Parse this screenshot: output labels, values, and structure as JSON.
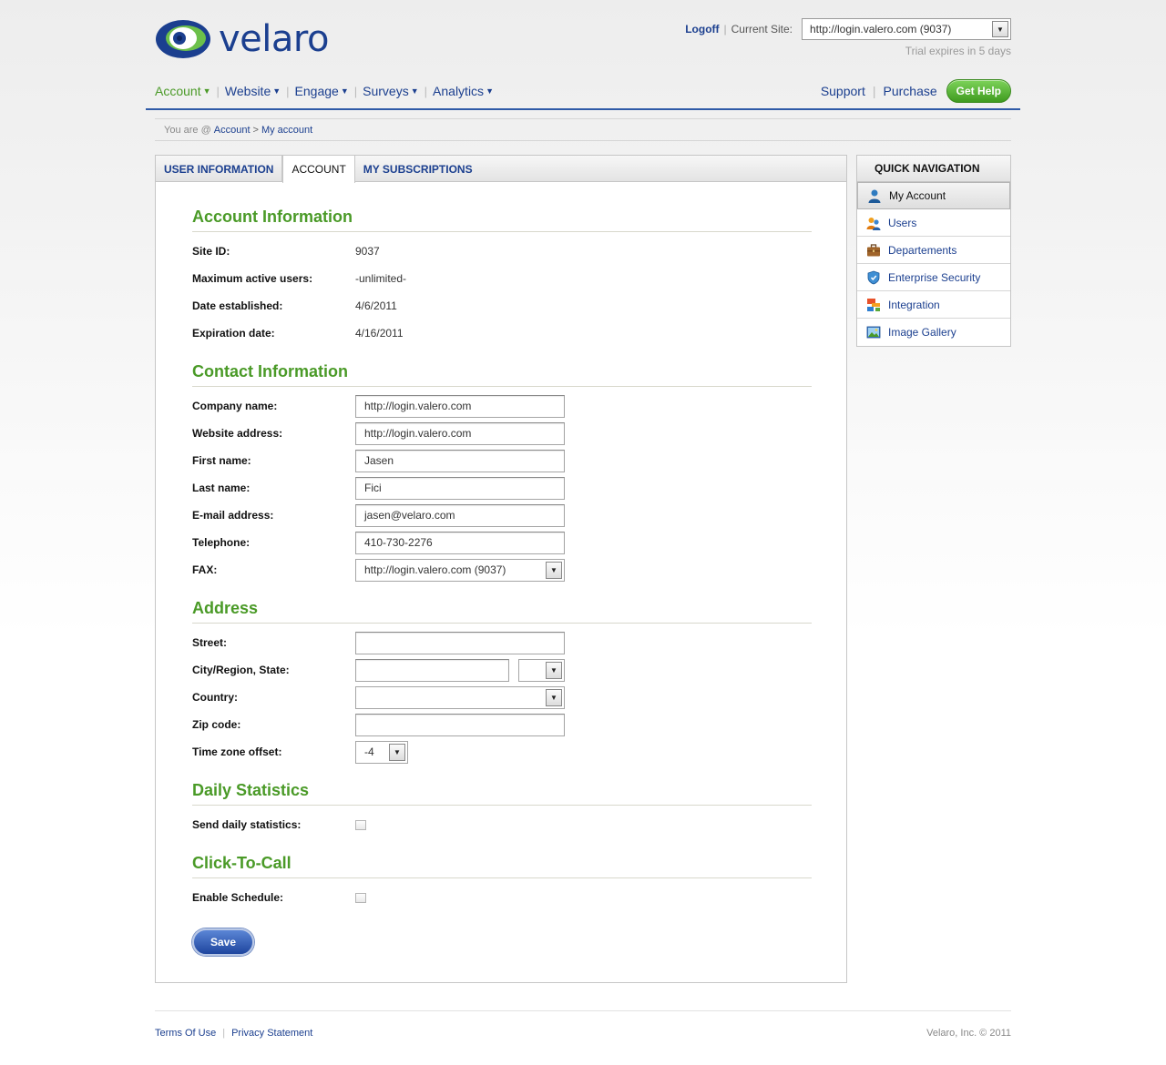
{
  "header": {
    "logo_text": "velaro",
    "logoff": "Logoff",
    "current_site_label": "Current Site:",
    "current_site_value": "http://login.valero.com (9037)",
    "trial": "Trial expires in 5 days"
  },
  "nav": {
    "items": [
      "Account",
      "Website",
      "Engage",
      "Surveys",
      "Analytics"
    ],
    "support": "Support",
    "purchase": "Purchase",
    "get_help": "Get Help"
  },
  "breadcrumb": {
    "prefix": "You are @",
    "level1": "Account",
    "level2": "My account"
  },
  "tabs": [
    "USER INFORMATION",
    "ACCOUNT",
    "MY SUBSCRIPTIONS"
  ],
  "account_info": {
    "title": "Account Information",
    "site_id_label": "Site ID:",
    "site_id": "9037",
    "max_users_label": "Maximum active users:",
    "max_users": "-unlimited-",
    "date_est_label": "Date established:",
    "date_est": "4/6/2011",
    "exp_label": "Expiration date:",
    "exp": "4/16/2011"
  },
  "contact": {
    "title": "Contact Information",
    "company_label": "Company name:",
    "company": "http://login.valero.com",
    "website_label": "Website address:",
    "website": "http://login.valero.com",
    "first_label": "First name:",
    "first": "Jasen",
    "last_label": "Last name:",
    "last": "Fici",
    "email_label": "E-mail address:",
    "email": "jasen@velaro.com",
    "phone_label": "Telephone:",
    "phone": "410-730-2276",
    "fax_label": "FAX:",
    "fax": "http://login.valero.com (9037)"
  },
  "address": {
    "title": "Address",
    "street_label": "Street:",
    "street": "",
    "city_label": "City/Region, State:",
    "city": "",
    "state": "",
    "country_label": "Country:",
    "country": "",
    "zip_label": "Zip code:",
    "zip": "",
    "tz_label": "Time zone offset:",
    "tz": "-4"
  },
  "daily": {
    "title": "Daily Statistics",
    "send_label": "Send daily statistics:",
    "send_checked": false
  },
  "ctc": {
    "title": "Click-To-Call",
    "enable_label": "Enable Schedule:",
    "enable_checked": false
  },
  "save_label": "Save",
  "quick_nav": {
    "title": "QUICK NAVIGATION",
    "items": [
      {
        "label": "My Account",
        "icon": "user-icon"
      },
      {
        "label": "Users",
        "icon": "users-icon"
      },
      {
        "label": "Departements",
        "icon": "briefcase-icon"
      },
      {
        "label": "Enterprise Security",
        "icon": "shield-icon"
      },
      {
        "label": "Integration",
        "icon": "integration-icon"
      },
      {
        "label": "Image Gallery",
        "icon": "image-icon"
      }
    ]
  },
  "footer": {
    "terms": "Terms Of Use",
    "privacy": "Privacy Statement",
    "copyright": "Velaro, Inc. © 2011"
  },
  "colors": {
    "brand_blue": "#1b3f8f",
    "accent_green": "#4a9a27",
    "nav_rule": "#2f5aa7"
  }
}
